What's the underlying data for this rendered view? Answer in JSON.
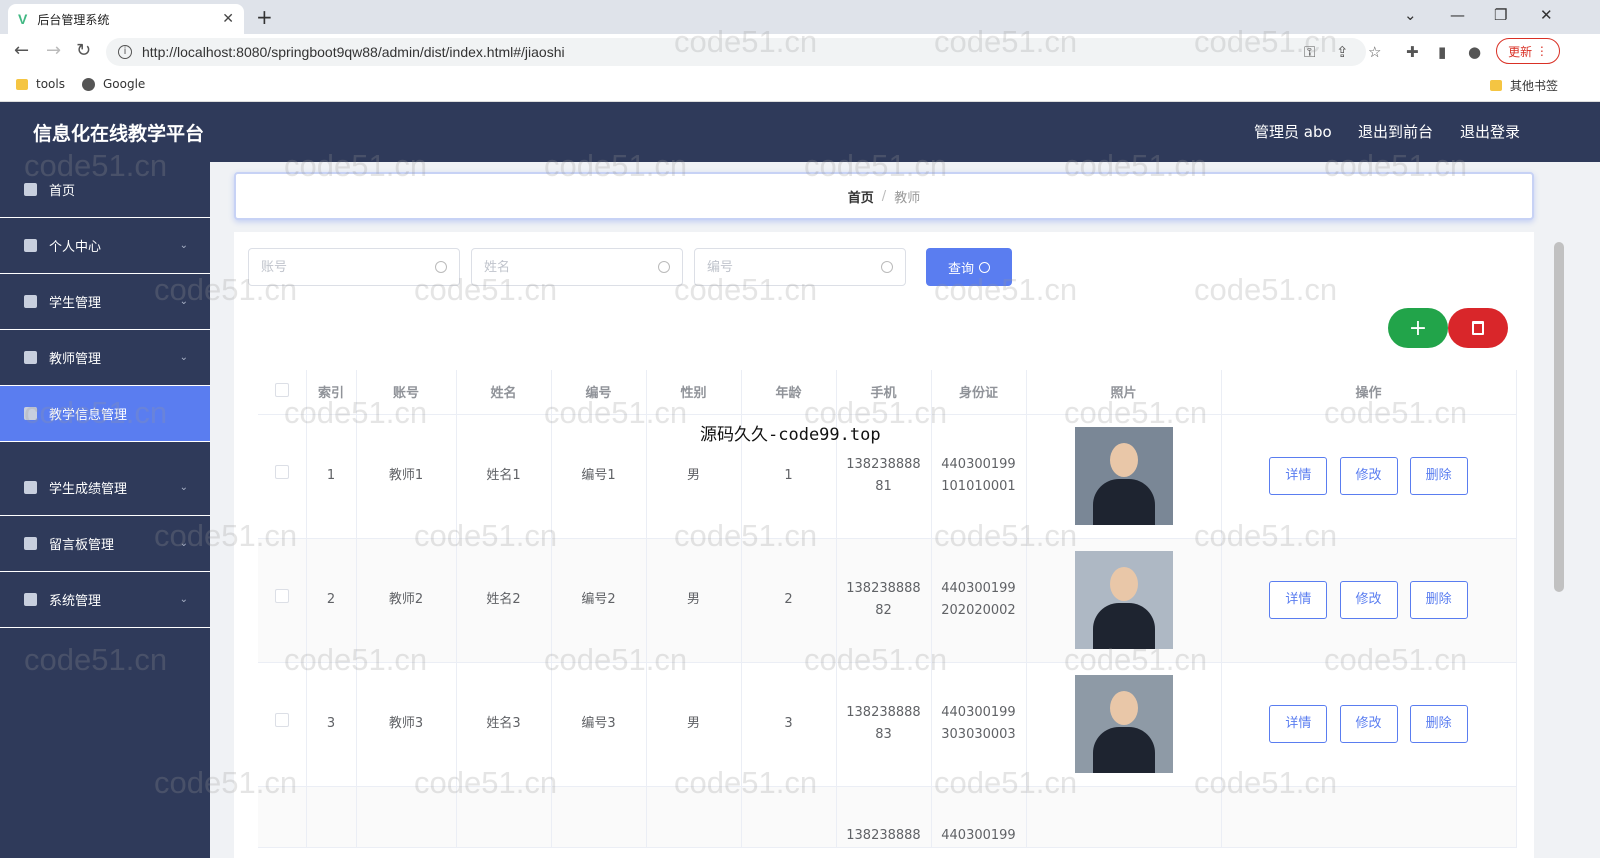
{
  "browser": {
    "tab_title": "后台管理系统",
    "tab_favicon": "V",
    "url": "http://localhost:8080/springboot9qw88/admin/dist/index.html#/jiaoshi",
    "update_label": "更新",
    "bookmarks": [
      "tools",
      "Google"
    ],
    "other_bookmarks": "其他书签"
  },
  "header": {
    "title": "信息化在线教学平台",
    "user": "管理员 abo",
    "front_link": "退出到前台",
    "logout_link": "退出登录"
  },
  "sidebar": {
    "items": [
      {
        "label": "首页",
        "icon": "home-icon"
      },
      {
        "label": "个人中心",
        "icon": "user-icon"
      },
      {
        "label": "学生管理",
        "icon": "student-icon"
      },
      {
        "label": "教师管理",
        "icon": "monitor-icon"
      },
      {
        "label": "教学信息管理",
        "icon": "book-icon",
        "active": true
      },
      {
        "label": "学生成绩管理",
        "icon": "grade-icon"
      },
      {
        "label": "留言板管理",
        "icon": "message-icon"
      },
      {
        "label": "系统管理",
        "icon": "settings-icon"
      }
    ]
  },
  "breadcrumb": {
    "home": "首页",
    "separator": "/",
    "current": "教师"
  },
  "search": {
    "account_placeholder": "账号",
    "name_placeholder": "姓名",
    "number_placeholder": "编号",
    "query_label": "查询"
  },
  "actions": {
    "add": "+"
  },
  "table": {
    "headers": [
      "索引",
      "账号",
      "姓名",
      "编号",
      "性别",
      "年龄",
      "手机",
      "身份证",
      "照片",
      "操作"
    ],
    "rows": [
      {
        "index": "1",
        "account": "教师1",
        "name": "姓名1",
        "number": "编号1",
        "gender": "男",
        "age": "1",
        "phone_a": "138238888",
        "phone_b": "81",
        "id_a": "440300199",
        "id_b": "101010001"
      },
      {
        "index": "2",
        "account": "教师2",
        "name": "姓名2",
        "number": "编号2",
        "gender": "男",
        "age": "2",
        "phone_a": "138238888",
        "phone_b": "82",
        "id_a": "440300199",
        "id_b": "202020002"
      },
      {
        "index": "3",
        "account": "教师3",
        "name": "姓名3",
        "number": "编号3",
        "gender": "男",
        "age": "3",
        "phone_a": "138238888",
        "phone_b": "83",
        "id_a": "440300199",
        "id_b": "303030003"
      },
      {
        "phone_a": "138238888",
        "id_a": "440300199"
      }
    ],
    "op_labels": {
      "detail": "详情",
      "edit": "修改",
      "delete": "删除"
    }
  },
  "overlay": "源码久久-code99.top",
  "watermark": "code51.cn"
}
